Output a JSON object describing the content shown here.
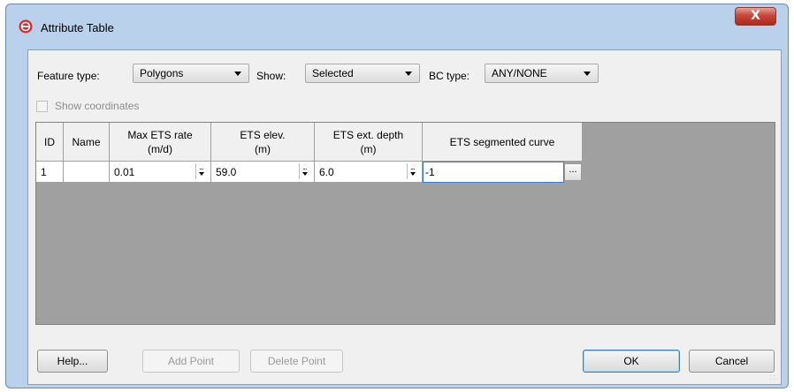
{
  "window": {
    "title": "Attribute Table",
    "close_label": "X"
  },
  "controls": {
    "feature_type_label": "Feature type:",
    "feature_type_value": "Polygons",
    "show_label": "Show:",
    "show_value": "Selected",
    "bc_type_label": "BC type:",
    "bc_type_value": "ANY/NONE",
    "show_coordinates_label": "Show coordinates",
    "show_coordinates_checked": false
  },
  "table": {
    "headers": {
      "id": "ID",
      "name": "Name",
      "max_ets_rate_1": "Max ETS rate",
      "max_ets_rate_2": "(m/d)",
      "ets_elev_1": "ETS elev.",
      "ets_elev_2": "(m)",
      "ets_ext_depth_1": "ETS ext. depth",
      "ets_ext_depth_2": "(m)",
      "ets_segmented_curve": "ETS segmented curve"
    },
    "rows": [
      {
        "id": "1",
        "name": "",
        "max_ets_rate": "0.01",
        "ets_elev": "59.0",
        "ets_ext_depth": "6.0",
        "ets_segmented_curve": "-1"
      }
    ],
    "ellipsis_label": "..."
  },
  "buttons": {
    "help": "Help...",
    "add_point": "Add Point",
    "delete_point": "Delete Point",
    "ok": "OK",
    "cancel": "Cancel"
  },
  "icons": {
    "app": "stop-sign-icon",
    "spinner": "spinner-icon",
    "ellipsis": "ellipsis-icon",
    "resize_grip": "resize-grip-icon"
  }
}
